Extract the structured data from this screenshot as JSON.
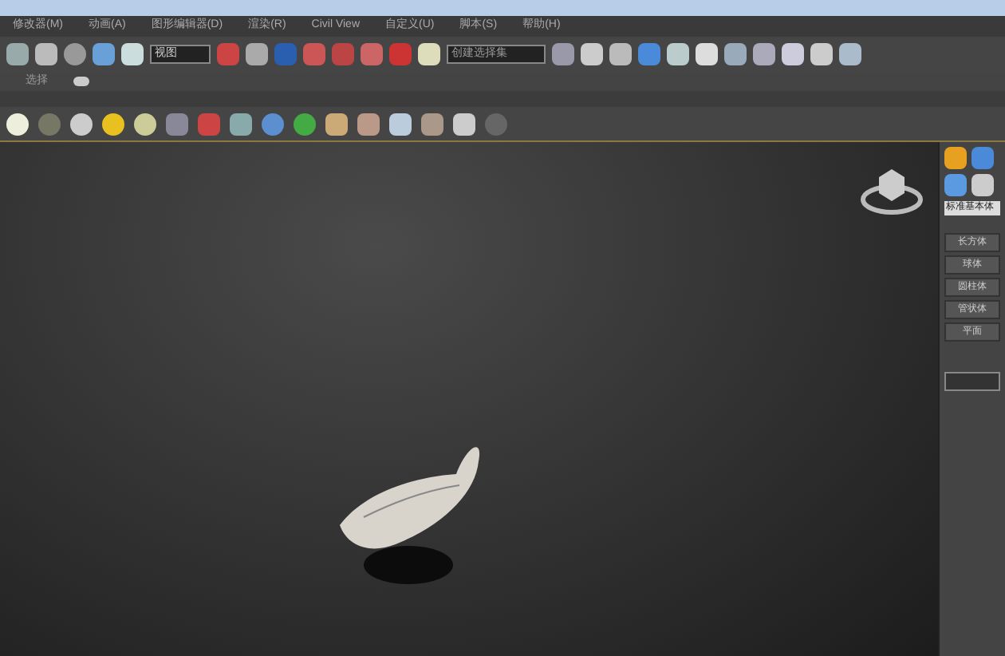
{
  "menu": [
    "修改器(M)",
    "动画(A)",
    "图形编辑器(D)",
    "渲染(R)",
    "Civil View",
    "自定义(U)",
    "脚本(S)",
    "帮助(H)"
  ],
  "toolbar": {
    "view_dropdown": "视图",
    "selection_set": "创建选择集"
  },
  "sub_toolbar": {
    "label": "选择"
  },
  "command_panel": {
    "category": "标准基本体",
    "buttons": [
      "长方体",
      "球体",
      "圆柱体",
      "管状体",
      "平面"
    ]
  }
}
